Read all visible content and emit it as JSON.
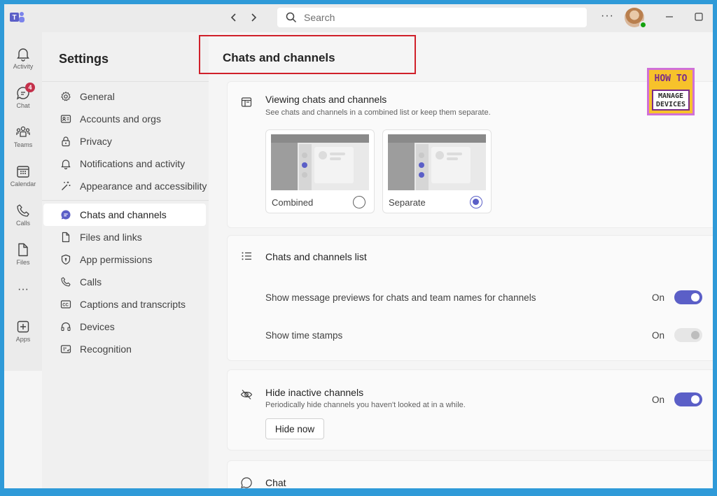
{
  "search": {
    "placeholder": "Search"
  },
  "window": {
    "more": "···"
  },
  "rail": [
    {
      "label": "Activity",
      "icon": "bell-icon"
    },
    {
      "label": "Chat",
      "icon": "chat-icon",
      "badge": "4"
    },
    {
      "label": "Teams",
      "icon": "teams-icon"
    },
    {
      "label": "Calendar",
      "icon": "calendar-icon"
    },
    {
      "label": "Calls",
      "icon": "phone-icon"
    },
    {
      "label": "Files",
      "icon": "file-icon"
    },
    {
      "label": "···",
      "icon": "more-apps-icon"
    },
    {
      "label": "Apps",
      "icon": "apps-icon"
    }
  ],
  "settings": {
    "title": "Settings",
    "nav_group1": [
      {
        "label": "General",
        "icon": "gear-icon"
      },
      {
        "label": "Accounts and orgs",
        "icon": "id-card-icon"
      },
      {
        "label": "Privacy",
        "icon": "lock-icon"
      },
      {
        "label": "Notifications and activity",
        "icon": "bell-icon"
      },
      {
        "label": "Appearance and accessibility",
        "icon": "wand-icon"
      }
    ],
    "nav_group2": [
      {
        "label": "Chats and channels",
        "icon": "chat-bubble-icon",
        "active": true
      },
      {
        "label": "Files and links",
        "icon": "file-icon"
      },
      {
        "label": "App permissions",
        "icon": "shield-icon"
      },
      {
        "label": "Calls",
        "icon": "phone-icon"
      },
      {
        "label": "Captions and transcripts",
        "icon": "captions-icon"
      },
      {
        "label": "Devices",
        "icon": "headset-icon"
      },
      {
        "label": "Recognition",
        "icon": "recognition-icon"
      }
    ]
  },
  "content": {
    "title": "Chats and channels",
    "viewing": {
      "heading": "Viewing chats and channels",
      "subtitle": "See chats and channels in a combined list or keep them separate.",
      "options": [
        {
          "label": "Combined",
          "selected": false
        },
        {
          "label": "Separate",
          "selected": true
        }
      ]
    },
    "list": {
      "heading": "Chats and channels list",
      "rows": [
        {
          "label": "Show message previews for chats and team names for channels",
          "state": "On",
          "enabled": true
        },
        {
          "label": "Show time stamps",
          "state": "On",
          "enabled": false
        }
      ]
    },
    "inactive": {
      "heading": "Hide inactive channels",
      "subtitle": "Periodically hide channels you haven't looked at in a while.",
      "state": "On",
      "button": "Hide now"
    },
    "chat": {
      "heading": "Chat"
    }
  },
  "logo": {
    "line1": "HOW TO",
    "line2": "MANAGE",
    "line3": "DEVICES"
  },
  "colors": {
    "accent": "#5b5fc7",
    "highlight_border": "#d0202a",
    "frame": "#2f9ad8",
    "badge": "#c4314b"
  }
}
